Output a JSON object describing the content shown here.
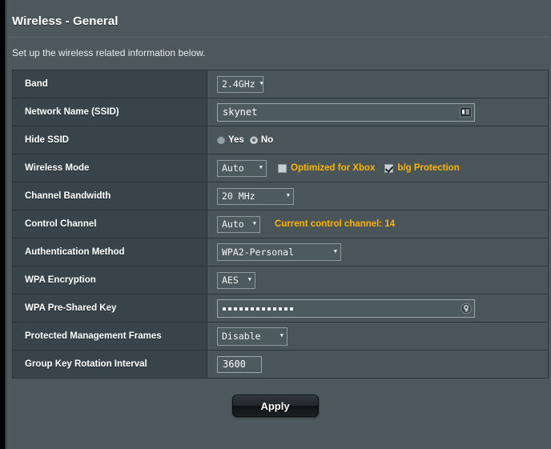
{
  "page": {
    "title": "Wireless - General",
    "description": "Set up the wireless related information below."
  },
  "rows": {
    "band": {
      "label": "Band",
      "value": "2.4GHz"
    },
    "ssid": {
      "label": "Network Name (SSID)",
      "value": "skynet",
      "icon": "contact-card-icon"
    },
    "hide_ssid": {
      "label": "Hide SSID",
      "options": [
        "Yes",
        "No"
      ],
      "selected": "No"
    },
    "wireless_mode": {
      "label": "Wireless Mode",
      "value": "Auto",
      "xbox_label": "Optimized for Xbox",
      "xbox_checked": false,
      "bg_label": "b/g Protection",
      "bg_checked": true
    },
    "channel_bandwidth": {
      "label": "Channel Bandwidth",
      "value": "20 MHz"
    },
    "control_channel": {
      "label": "Control Channel",
      "value": "Auto",
      "note": "Current control channel: 14"
    },
    "auth_method": {
      "label": "Authentication Method",
      "value": "WPA2-Personal"
    },
    "wpa_encryption": {
      "label": "WPA Encryption",
      "value": "AES"
    },
    "psk": {
      "label": "WPA Pre-Shared Key",
      "masked_length": 13,
      "icon": "key-password-icon"
    },
    "pmf": {
      "label": "Protected Management Frames",
      "value": "Disable"
    },
    "group_key": {
      "label": "Group Key Rotation Interval",
      "value": "3600"
    }
  },
  "footer": {
    "apply_label": "Apply"
  },
  "colors": {
    "page_bg": "#4d585c",
    "label_cell": "#39444a",
    "value_cell": "#4a555a",
    "accent_orange": "#ffb400",
    "border": "#2c3539"
  }
}
